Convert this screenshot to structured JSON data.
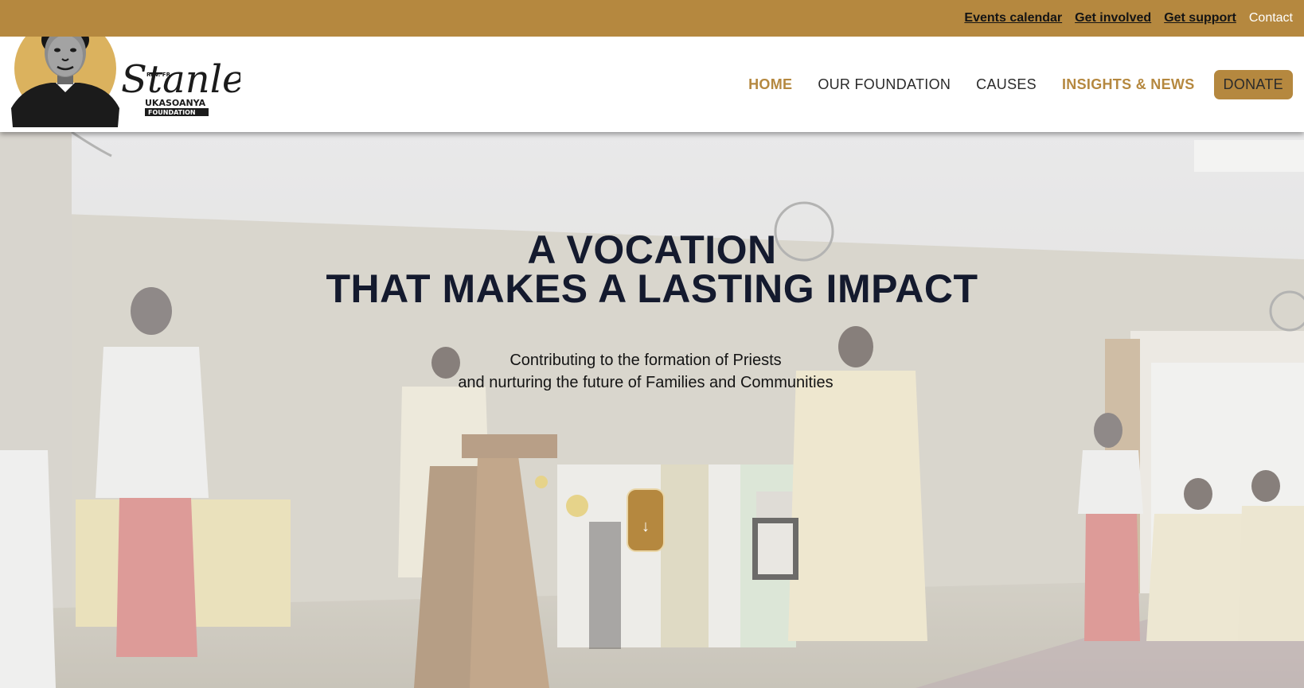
{
  "utility_nav": {
    "events": "Events calendar",
    "involved": "Get involved",
    "support": "Get support",
    "contact": "Contact"
  },
  "logo": {
    "small": "REV. FR.",
    "script": "Stanley",
    "name": "UKASOANYA",
    "tag": "FOUNDATION"
  },
  "main_nav": {
    "home": "HOME",
    "foundation": "OUR FOUNDATION",
    "causes": "CAUSES",
    "insights": "INSIGHTS & NEWS",
    "donate": "DONATE"
  },
  "hero": {
    "title_line1": "A VOCATION",
    "title_line2": "THAT MAKES A LASTING IMPACT",
    "subtitle_line1": "Contributing to the formation of Priests",
    "subtitle_line2": "and nurturing the future of Families and Communities",
    "scroll_icon": "↓"
  },
  "colors": {
    "brand_gold": "#b5883f",
    "title_navy": "#141a2e",
    "header_bg": "#ffffff"
  },
  "icons": {
    "scroll": "arrow-down-icon"
  }
}
